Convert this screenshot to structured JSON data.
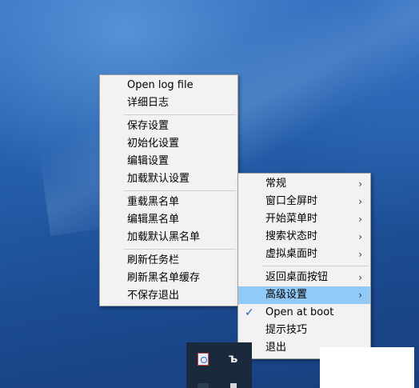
{
  "main_menu": {
    "groups": [
      [
        "Open log file",
        "详细日志"
      ],
      [
        "保存设置",
        "初始化设置",
        "编辑设置",
        "加载默认设置"
      ],
      [
        "重载黑名单",
        "编辑黑名单",
        "加载默认黑名单"
      ],
      [
        "刷新任务栏",
        "刷新黑名单缓存",
        "不保存退出"
      ]
    ]
  },
  "sub_menu": {
    "items": [
      {
        "label": "常规",
        "submenu": true
      },
      {
        "label": "窗口全屏时",
        "submenu": true
      },
      {
        "label": "开始菜单时",
        "submenu": true
      },
      {
        "label": "搜索状态时",
        "submenu": true
      },
      {
        "label": "虚拟桌面时",
        "submenu": true
      },
      {
        "label": "返回桌面按钮",
        "submenu": true
      },
      {
        "label": "高级设置",
        "submenu": true,
        "highlighted": true
      },
      {
        "label": "Open at boot",
        "checked": true
      },
      {
        "label": "提示技巧"
      },
      {
        "label": "退出"
      }
    ],
    "arrow_glyph": "›",
    "check_glyph": "✓"
  },
  "tray": {
    "icon2_glyph": "ъ"
  },
  "colors": {
    "highlight": "#91c9f7",
    "menu_bg": "#f2f2f2",
    "desktop": "#245da9"
  }
}
